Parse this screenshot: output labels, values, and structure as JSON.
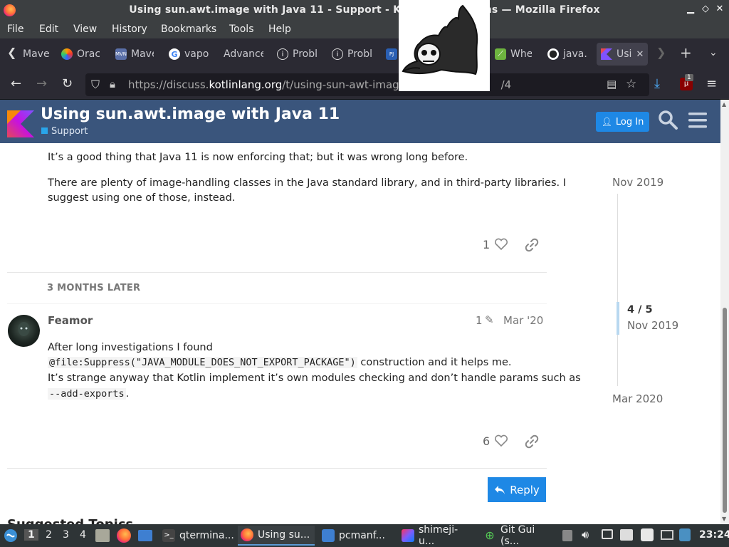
{
  "window": {
    "title": "Using sun.awt.image with Java 11 - Support - Kotlin Discussions — Mozilla Firefox"
  },
  "menu": [
    "File",
    "Edit",
    "View",
    "History",
    "Bookmarks",
    "Tools",
    "Help"
  ],
  "tabs": [
    {
      "label": "Mave",
      "icon": "maven-icon"
    },
    {
      "label": "Orac",
      "icon": "oracle-icon"
    },
    {
      "label": "Mave",
      "icon": "mvn-repo-icon"
    },
    {
      "label": "vapo",
      "icon": "google-icon"
    },
    {
      "label": "Advance",
      "icon": "none"
    },
    {
      "label": "Probl",
      "icon": "info-icon"
    },
    {
      "label": "Probl",
      "icon": "info-icon"
    },
    {
      "label": "Whe",
      "icon": "spring-icon"
    },
    {
      "label": "java.",
      "icon": "github-icon"
    },
    {
      "label": "Usi",
      "icon": "kotlin-icon"
    }
  ],
  "urlbar": {
    "prefix": "https://discuss.",
    "domain": "kotlinlang.org",
    "path": "/t/using-sun-awt-image-w",
    "suffix": "/4"
  },
  "badge_count": "1",
  "topic": {
    "title": "Using sun.awt.image with Java 11",
    "category": "Support",
    "login_label": "Log In"
  },
  "post1": {
    "line1": "It’s a good thing that Java 11 is now enforcing that; but it was wrong long before.",
    "line2": "There are plenty of image-handling classes in the Java standard library, and in third-party libraries. I",
    "line3": "suggest using one of those, instead.",
    "likes": "1"
  },
  "gap_label": "3 MONTHS LATER",
  "post2": {
    "author": "Feamor",
    "edits": "1",
    "date": "Mar '20",
    "text1": "After long investigations I found",
    "code1": "@file:Suppress(\"JAVA_MODULE_DOES_NOT_EXPORT_PACKAGE\")",
    "text2": " construction and it helps me.",
    "text3": "It’s strange anyway that Kotlin implement it’s own modules checking and don’t handle params such as",
    "code2": "--add-exports",
    "text4": ".",
    "likes": "6"
  },
  "reply_label": "Reply",
  "timeline": {
    "top": "Nov 2019",
    "position": "4 / 5",
    "position_date": "Nov 2019",
    "bottom": "Mar 2020"
  },
  "suggested_heading": "Suggested Topics",
  "taskbar": {
    "workspaces": [
      "1",
      "2",
      "3",
      "4"
    ],
    "tasks": [
      {
        "label": "qtermina...",
        "icon": "terminal-icon"
      },
      {
        "label": "Using su...",
        "icon": "firefox-icon"
      },
      {
        "label": "pcmanf...",
        "icon": "folder-icon"
      },
      {
        "label": "shimeji-u...",
        "icon": "intellij-icon"
      },
      {
        "label": "Git Gui (s...",
        "icon": "git-icon"
      }
    ],
    "clock": "23:24"
  }
}
